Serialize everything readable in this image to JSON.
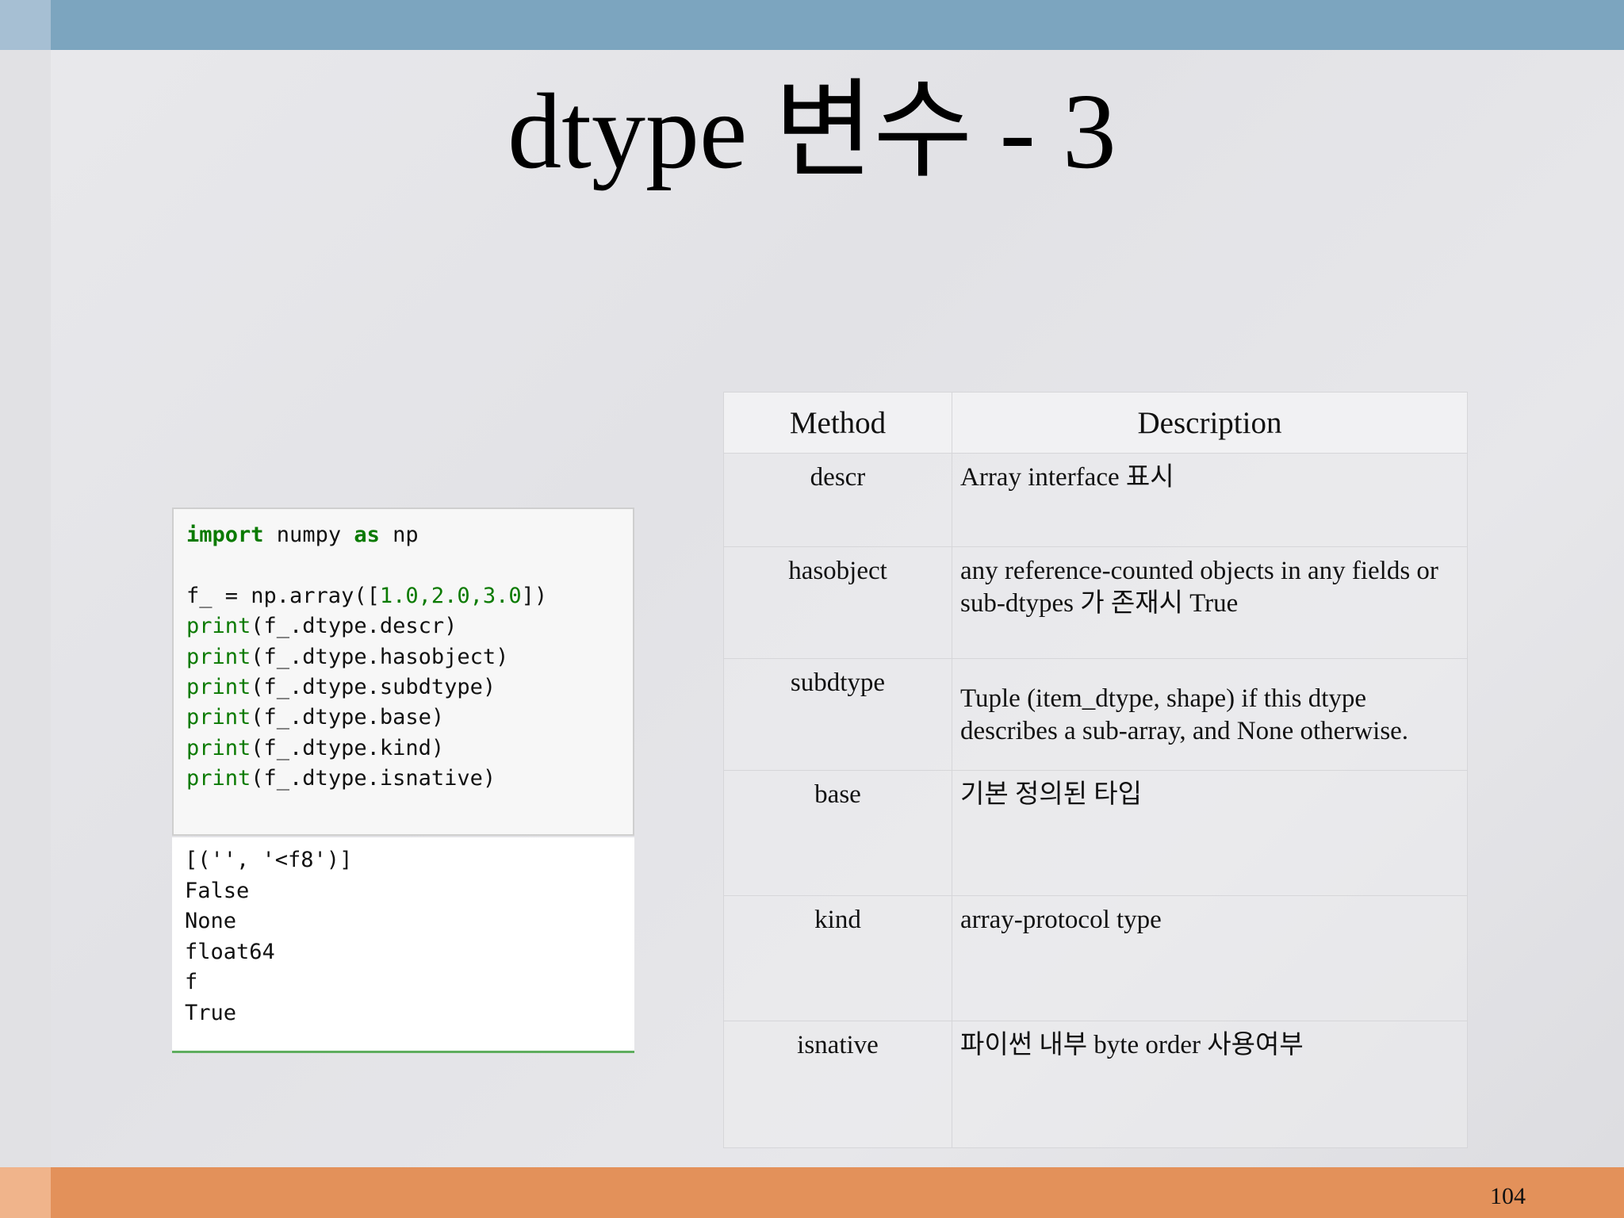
{
  "slide": {
    "title": "dtype 변수 - 3",
    "page_number": "104"
  },
  "code_cell": {
    "line1_kw1": "import",
    "line1_mid": " numpy ",
    "line1_kw2": "as",
    "line1_end": " np",
    "line2_pre": "f_ = np.array([",
    "line2_nums": "1.0,2.0,3.0",
    "line2_post": "])",
    "print_kw": "print",
    "lines": [
      "(f_.dtype.descr)",
      "(f_.dtype.hasobject)",
      "(f_.dtype.subdtype)",
      "(f_.dtype.base)",
      "(f_.dtype.kind)",
      "(f_.dtype.isnative)"
    ]
  },
  "output_cell": {
    "lines": [
      "[('', '<f8')]",
      "False",
      "None",
      "float64",
      "f",
      "True"
    ]
  },
  "table": {
    "headers": [
      "Method",
      "Description"
    ],
    "rows": [
      {
        "method": "descr",
        "description": "Array interface 표시"
      },
      {
        "method": "hasobject",
        "description": " any reference-counted objects in any fields or sub-dtypes 가 존재시 True"
      },
      {
        "method": "subdtype",
        "description": "Tuple (item_dtype, shape) if this dtype describes a sub-array, and None otherwise."
      },
      {
        "method": "base",
        "description": "기본 정의된 타입"
      },
      {
        "method": "kind",
        "description": "array-protocol type"
      },
      {
        "method": "isnative",
        "description": "파이썬 내부 byte order 사용여부"
      }
    ]
  }
}
